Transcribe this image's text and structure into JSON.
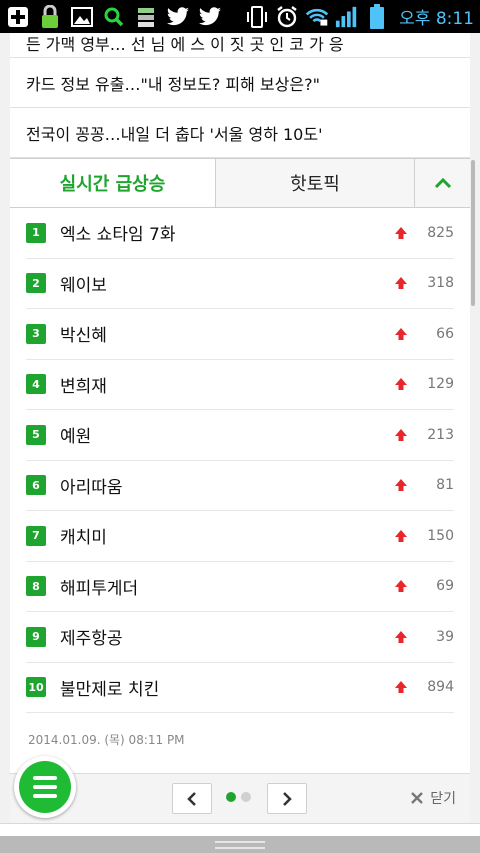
{
  "status_bar": {
    "time": "오후 8:11",
    "left_icons": [
      "plus-icon",
      "lock-icon",
      "image-icon",
      "search-icon",
      "stack-icon",
      "twitter-icon",
      "twitter-icon"
    ],
    "right_icons": [
      "vibrate-icon",
      "alarm-icon",
      "wifi-icon",
      "signal-icon",
      "battery-icon"
    ]
  },
  "news": {
    "partial_top": "든 가맥 영부…  선 님 에  스 이 짓 곳 인 코  가 응",
    "items": [
      "카드 정보 유출…\"내 정보도? 피해 보상은?\"",
      "전국이 꽁꽁…내일 더 춥다 '서울 영하 10도'"
    ]
  },
  "tabs": {
    "realtime": "실시간 급상승",
    "hot_topic": "핫토픽"
  },
  "ranking": [
    {
      "rank": "1",
      "name": "엑소 쇼타임 7화",
      "score": "825"
    },
    {
      "rank": "2",
      "name": "웨이보",
      "score": "318"
    },
    {
      "rank": "3",
      "name": "박신혜",
      "score": "66"
    },
    {
      "rank": "4",
      "name": "변희재",
      "score": "129"
    },
    {
      "rank": "5",
      "name": "예원",
      "score": "213"
    },
    {
      "rank": "6",
      "name": "아리따움",
      "score": "81"
    },
    {
      "rank": "7",
      "name": "캐치미",
      "score": "150"
    },
    {
      "rank": "8",
      "name": "해피투게더",
      "score": "69"
    },
    {
      "rank": "9",
      "name": "제주항공",
      "score": "39"
    },
    {
      "rank": "10",
      "name": "불만제로 치킨",
      "score": "894"
    }
  ],
  "timestamp": "2014.01.09. (목) 08:11 PM",
  "pager": {
    "close_label": "닫기",
    "page_count": 2,
    "current_page": 1
  },
  "colors": {
    "accent": "#1fa52f",
    "up_arrow": "#e8262b"
  }
}
